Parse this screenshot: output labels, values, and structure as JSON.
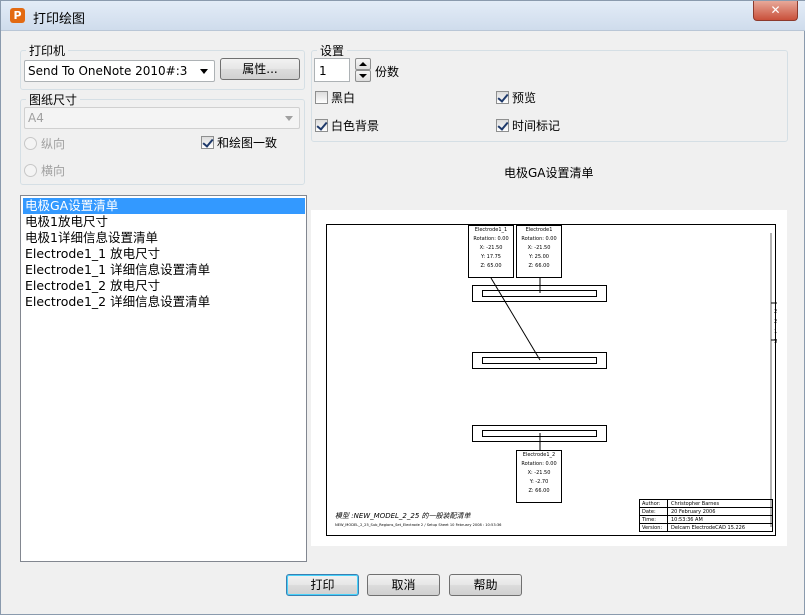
{
  "window": {
    "title": "打印绘图",
    "app_icon": "P",
    "close_label": "✕"
  },
  "printer": {
    "group_label": "打印机",
    "selected": "Send To OneNote 2010#:3",
    "properties_label": "属性..."
  },
  "paper": {
    "group_label": "图纸尺寸",
    "selected": "A4",
    "portrait_label": "纵向",
    "landscape_label": "横向",
    "match_label": "和绘图一致",
    "match_checked": true
  },
  "settings": {
    "group_label": "设置",
    "copies_value": "1",
    "copies_label": "份数",
    "bw_label": "黑白",
    "bw_checked": false,
    "preview_label": "预览",
    "preview_checked": true,
    "white_bg_label": "白色背景",
    "white_bg_checked": true,
    "timestamp_label": "时间标记",
    "timestamp_checked": true
  },
  "list": {
    "items": [
      "电极GA设置清单",
      "电极1放电尺寸",
      "电极1详细信息设置清单",
      "Electrode1_1 放电尺寸",
      "Electrode1_1 详细信息设置清单",
      "Electrode1_2 放电尺寸",
      "Electrode1_2 详细信息设置清单"
    ],
    "selected_index": 0
  },
  "preview": {
    "title": "电极GA设置清单",
    "box1": [
      "Electrode1_1",
      "Rotation: 0.00",
      "X:    -21.50",
      "Y:      17.75",
      "Z:      65.00"
    ],
    "box2": [
      "Electrode1",
      "Rotation: 0.00",
      "X:    -21.50",
      "Y:      25.00",
      "Z:      66.00"
    ],
    "box3": [
      "Electrode1_2",
      "Rotation: 0.00",
      "X:    -21.50",
      "Y:      -2.70",
      "Z:      66.00"
    ],
    "model_text": "模型 :NEW_MODEL_2_25 的一般装配清单",
    "small_text": "NEW_MODEL_2_25_Sub_Regions_Set_Electrode 2 / Setup Sheet 10 February 2008 : 10:53:36",
    "side_marks": [
      "2",
      "2",
      "1",
      "3",
      "2"
    ],
    "table": [
      {
        "k": "Author:",
        "v": "Christopher Barnes"
      },
      {
        "k": "Date:",
        "v": "20 February 2006"
      },
      {
        "k": "Time:",
        "v": "10:53:36 AM"
      },
      {
        "k": "Version:",
        "v": "Delcam ElectrodeCAD 15.226"
      }
    ]
  },
  "buttons": {
    "print": "打印",
    "cancel": "取消",
    "help": "帮助"
  }
}
